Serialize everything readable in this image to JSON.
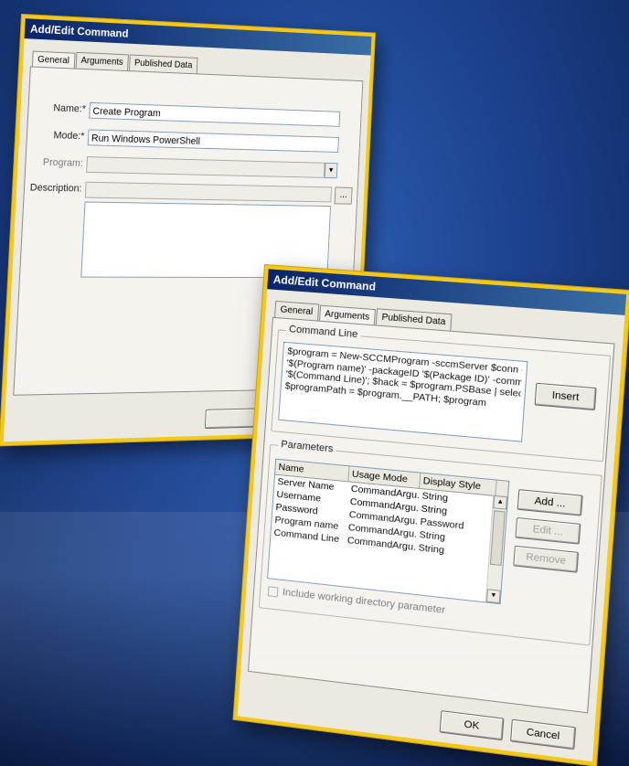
{
  "dialog1": {
    "title": "Add/Edit Command",
    "tabs": [
      "General",
      "Arguments",
      "Published Data"
    ],
    "name_label": "Name:*",
    "name_value": "Create Program",
    "mode_label": "Mode:*",
    "mode_value": "Run Windows PowerShell",
    "program_label": "Program:",
    "program_value": "",
    "description_label": "Description:",
    "browse_label": "..."
  },
  "dialog2": {
    "title": "Add/Edit Command",
    "tabs": [
      "General",
      "Arguments",
      "Published Data"
    ],
    "command_line_group": "Command Line",
    "command_lines": [
      "$program = New-SCCMProgram -sccmServer $conn -name",
      "'$(Program name)' -packageID '$(Package ID)' -commandLine",
      "'$(Command Line)'; $hack = $program.PSBase | select * | Out-Null;",
      "$programPath = $program.__PATH; $program"
    ],
    "insert_label": "Insert",
    "parameters_group": "Parameters",
    "columns": [
      "Name",
      "Usage Mode",
      "Display Style"
    ],
    "rows": [
      [
        "Server Name",
        "CommandArgu...",
        "String"
      ],
      [
        "Username",
        "CommandArgu...",
        "String"
      ],
      [
        "Password",
        "CommandArgu...",
        "Password"
      ],
      [
        "Program name",
        "CommandArgu...",
        "String"
      ],
      [
        "Command Line",
        "CommandArgu...",
        "String"
      ]
    ],
    "add_label": "Add ...",
    "edit_label": "Edit ...",
    "remove_label": "Remove",
    "include_label": "Include working directory parameter",
    "ok_label": "OK",
    "cancel_label": "Cancel"
  },
  "colors": {
    "accent_border": "#f2c81a",
    "title_bar": "#0a246a",
    "background": "#1d4390"
  }
}
